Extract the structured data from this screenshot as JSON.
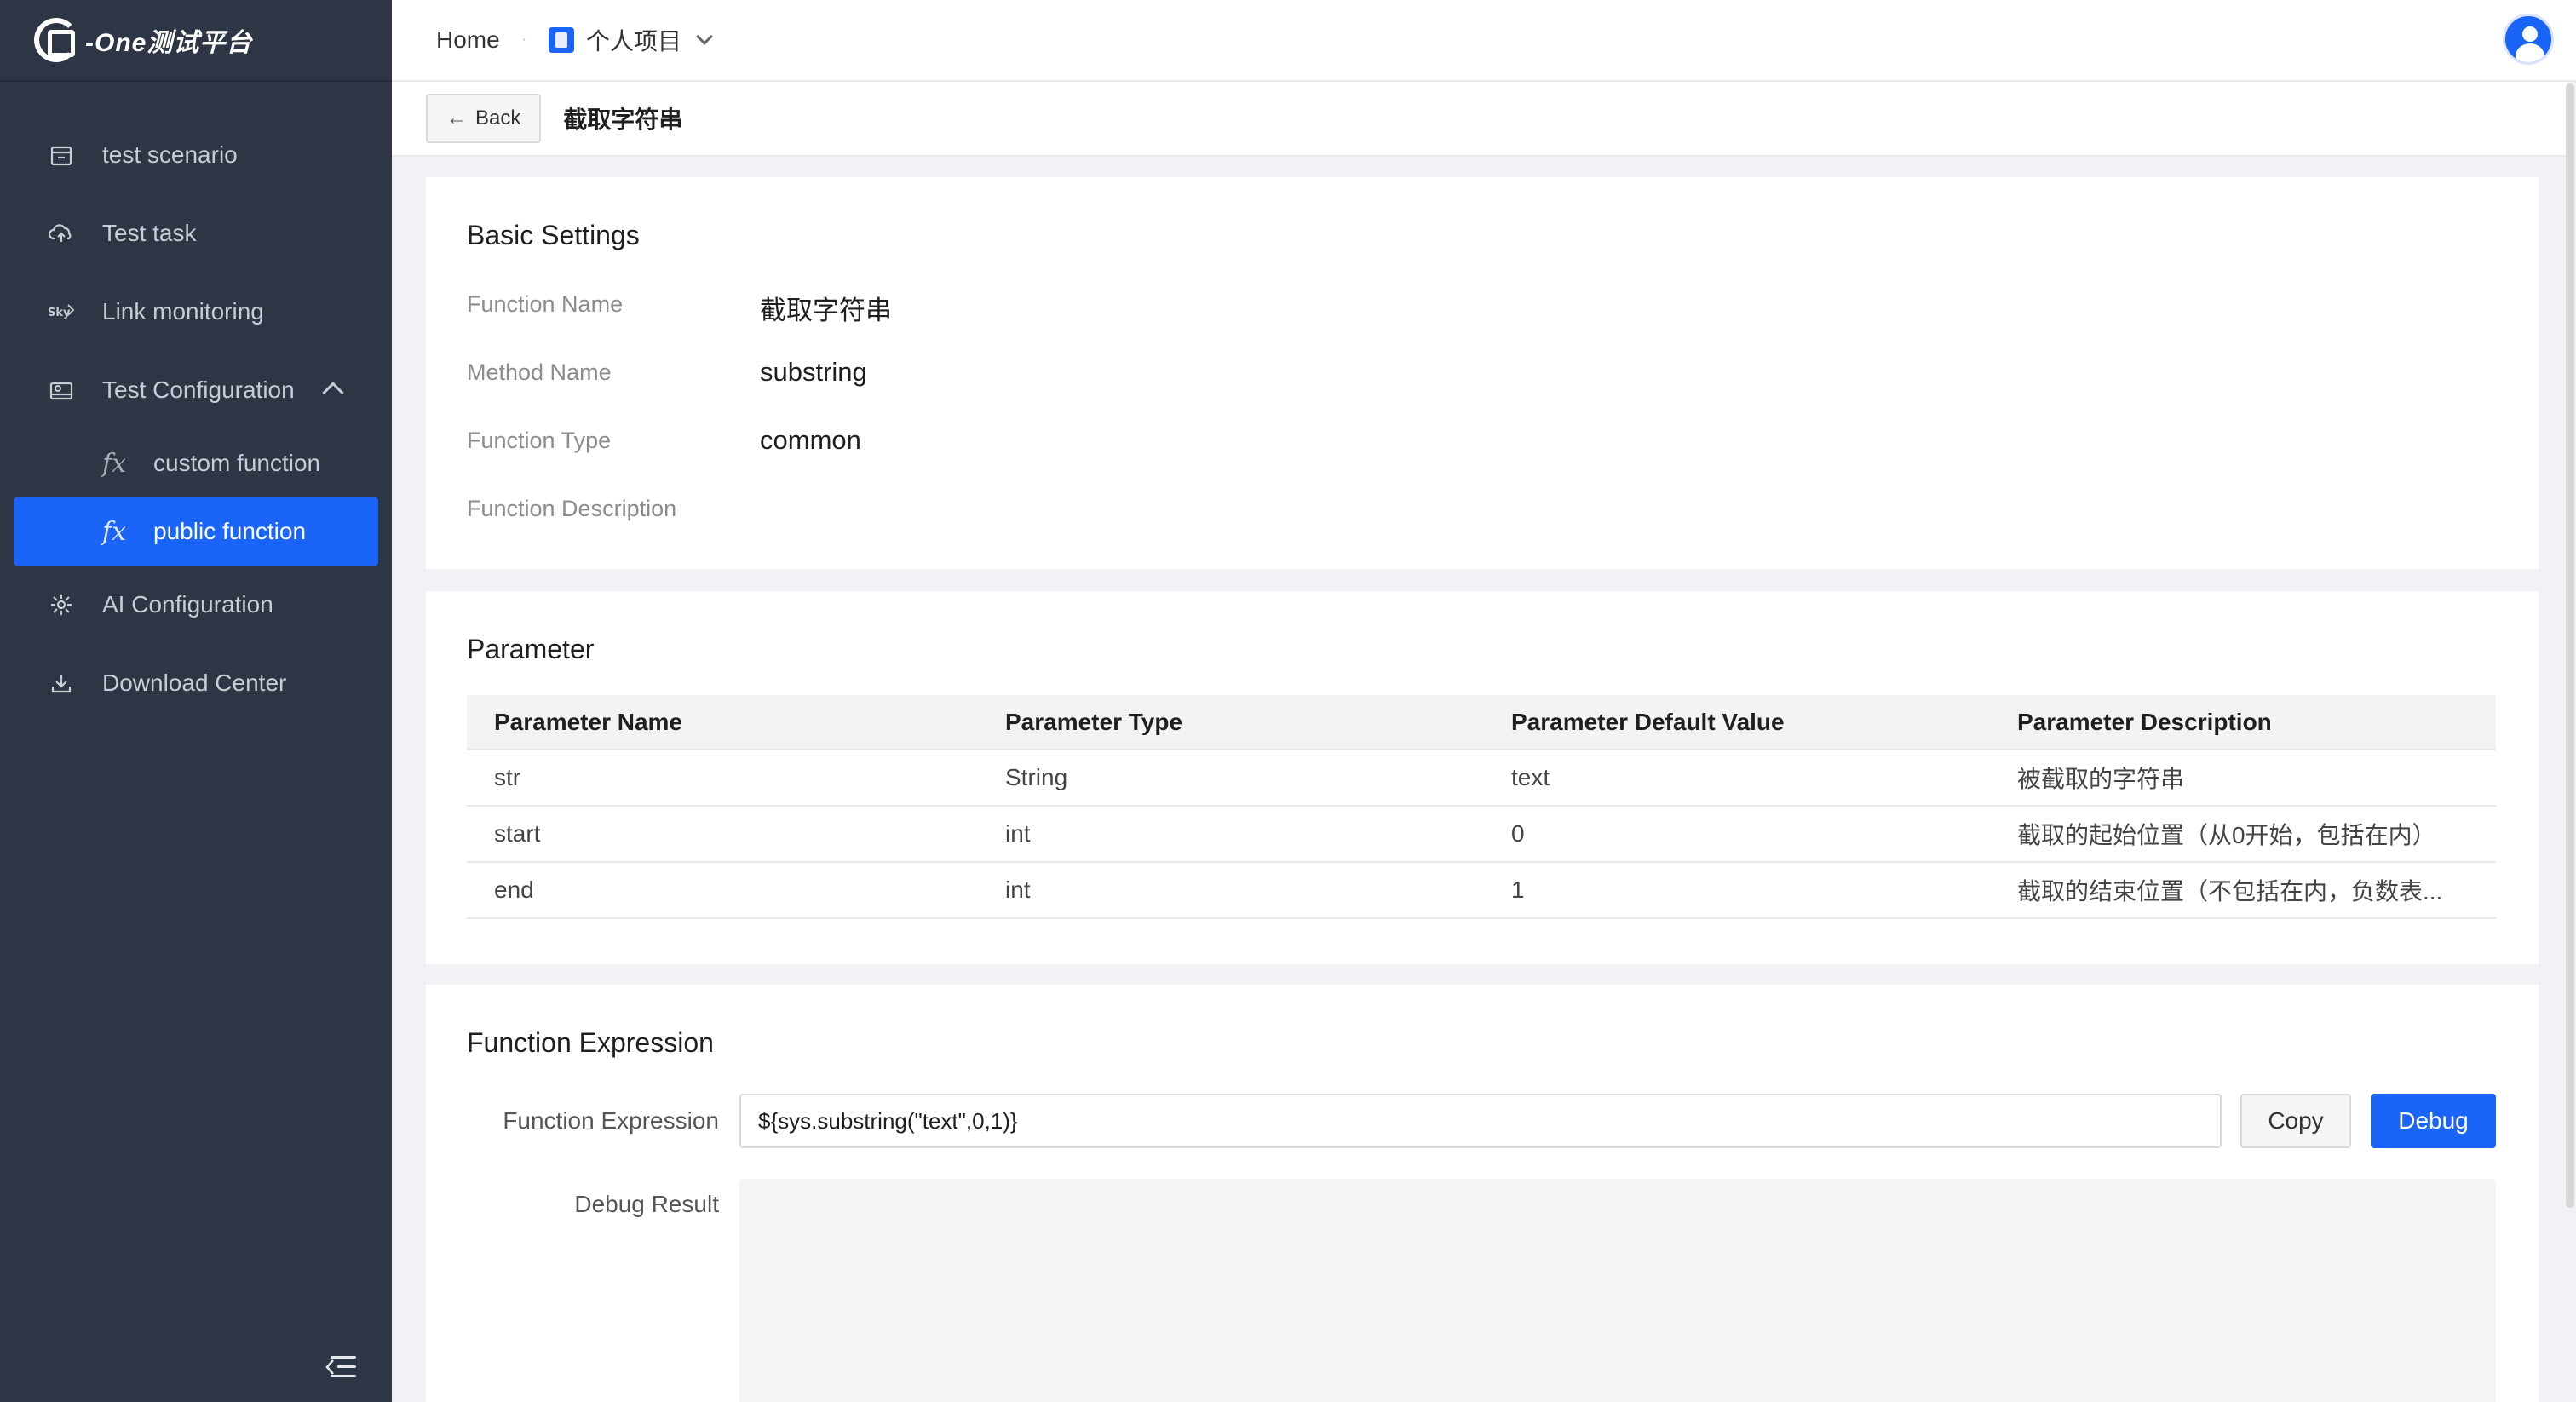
{
  "app": {
    "logo_text": "-One测试平台"
  },
  "sidebar": {
    "items": [
      {
        "label": "test scenario",
        "icon": "calendar-icon"
      },
      {
        "label": "Test task",
        "icon": "cloud-upload-icon"
      },
      {
        "label": "Link monitoring",
        "icon": "skywalking-icon"
      },
      {
        "label": "Test Configuration",
        "icon": "config-icon",
        "expanded": true
      },
      {
        "label": "AI Configuration",
        "icon": "ai-icon"
      },
      {
        "label": "Download Center",
        "icon": "download-icon"
      }
    ],
    "sub_items": [
      {
        "label": "custom function",
        "icon": "fx-icon"
      },
      {
        "label": "public function",
        "icon": "fx-icon",
        "active": true
      }
    ],
    "fx_glyph": "fx"
  },
  "header": {
    "home": "Home",
    "separator": "·",
    "project": "个人项目"
  },
  "subheader": {
    "back_label": "Back",
    "back_arrow": "←",
    "title": "截取字符串"
  },
  "basic": {
    "title": "Basic Settings",
    "fields": [
      {
        "label": "Function Name",
        "value": "截取字符串"
      },
      {
        "label": "Method Name",
        "value": "substring"
      },
      {
        "label": "Function Type",
        "value": "common"
      },
      {
        "label": "Function Description",
        "value": ""
      }
    ]
  },
  "parameter": {
    "title": "Parameter",
    "columns": [
      "Parameter Name",
      "Parameter Type",
      "Parameter Default Value",
      "Parameter Description"
    ],
    "rows": [
      [
        "str",
        "String",
        "text",
        "被截取的字符串"
      ],
      [
        "start",
        "int",
        "0",
        "截取的起始位置（从0开始，包括在内）"
      ],
      [
        "end",
        "int",
        "1",
        "截取的结束位置（不包括在内，负数表..."
      ]
    ]
  },
  "expression": {
    "title": "Function Expression",
    "label": "Function Expression",
    "value": "${sys.substring(\"text\",0,1)}",
    "copy_label": "Copy",
    "debug_label": "Debug",
    "result_label": "Debug Result"
  },
  "colors": {
    "sidebar_bg": "#2e3544",
    "accent": "#1a64f8"
  }
}
